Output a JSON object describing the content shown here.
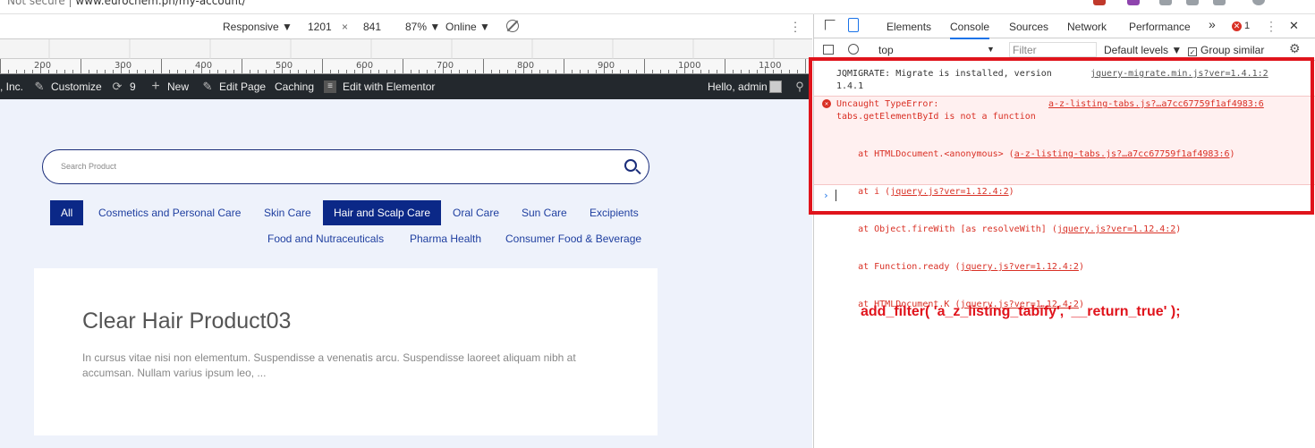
{
  "browser": {
    "url_prefix": "Not secure",
    "url_host": "www.eurochem.ph/my-account/"
  },
  "device_toolbar": {
    "mode": "Responsive ▼",
    "width": "1201",
    "times": "×",
    "height": "841",
    "zoom": "87% ▼",
    "network": "Online ▼"
  },
  "ruler": {
    "labels": [
      "200",
      "300",
      "400",
      "500",
      "600",
      "700",
      "800",
      "900",
      "1000",
      "1100"
    ]
  },
  "admin_bar": {
    "company": ", Inc.",
    "customize": "Customize",
    "updates": "9",
    "new": "New",
    "edit_page": "Edit Page",
    "caching": "Caching",
    "elementor": "Edit with Elementor",
    "greeting": "Hello, admin"
  },
  "site": {
    "search_placeholder": "Search Product",
    "categories": [
      "All",
      "Cosmetics and Personal Care",
      "Skin Care",
      "Hair and Scalp Care",
      "Oral Care",
      "Sun Care",
      "Excipients",
      "Food and Nutraceuticals",
      "Pharma Health",
      "Consumer Food & Beverage"
    ],
    "product": {
      "title": "Clear Hair Product03",
      "excerpt": "In cursus vitae nisi non elementum. Suspendisse a venenatis arcu. Suspendisse laoreet aliquam nibh at accumsan. Nullam varius ipsum leo, ..."
    }
  },
  "devtools": {
    "tabs": [
      "Elements",
      "Console",
      "Sources",
      "Network",
      "Performance"
    ],
    "more": "»",
    "error_count": "1",
    "context": "top",
    "filter_placeholder": "Filter",
    "levels": "Default levels ▼",
    "group_similar": "Group similar",
    "messages": {
      "m1_line1": "JQMIGRATE: Migrate is installed, version",
      "m1_line2": "1.4.1",
      "m1_src": "jquery-migrate.min.js?ver=1.4.1:2",
      "err_line1": "Uncaught TypeError:",
      "err_src": "a-z-listing-tabs.js?…a7cc67759f1af4983:6",
      "err_line2": "tabs.getElementById is not a function",
      "trace": [
        {
          "pre": "    at HTMLDocument.<anonymous> (",
          "link": "a-z-listing-tabs.js?…a7cc67759f1af4983:6",
          "post": ")"
        },
        {
          "pre": "    at i (",
          "link": "jquery.js?ver=1.12.4:2",
          "post": ")"
        },
        {
          "pre": "    at Object.fireWith [as resolveWith] (",
          "link": "jquery.js?ver=1.12.4:2",
          "post": ")"
        },
        {
          "pre": "    at Function.ready (",
          "link": "jquery.js?ver=1.12.4:2",
          "post": ")"
        },
        {
          "pre": "    at HTMLDocument.K (",
          "link": "jquery.js?ver=1.12.4:2",
          "post": ")"
        }
      ],
      "prompt": "›"
    }
  },
  "annotation": {
    "text": "add_filter( 'a_z_listing_tabify', '__return_true' );",
    "color": "#e0141c"
  }
}
